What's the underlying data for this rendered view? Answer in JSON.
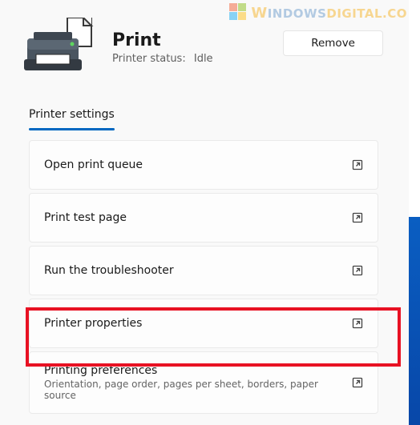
{
  "watermark": {
    "letter": "W",
    "rest": "INDOWS",
    "suffix": "DIGITAL.CO"
  },
  "header": {
    "title": "Print",
    "status_label": "Printer status:",
    "status_value": "Idle",
    "remove_label": "Remove"
  },
  "tabs": {
    "active": "Printer settings"
  },
  "settings": {
    "items": [
      {
        "label": "Open print queue"
      },
      {
        "label": "Print test page"
      },
      {
        "label": "Run the troubleshooter"
      },
      {
        "label": "Printer properties"
      },
      {
        "label": "Printing preferences",
        "desc": "Orientation, page order, pages per sheet, borders, paper source"
      }
    ]
  }
}
